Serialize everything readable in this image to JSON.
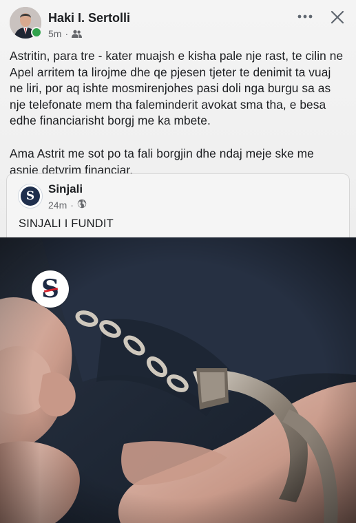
{
  "post": {
    "author": "Haki I. Sertolli",
    "time": "5m",
    "audience_icon": "friends-icon",
    "paragraphs": [
      "Astritin, para tre - kater muajsh e kisha pale nje rast, te cilin ne Apel arritem ta lirojme dhe qe pjesen tjeter te denimit ta vuaj ne liri, por aq ishte mosmirenjohes pasi doli nga burgu sa as nje telefonate mem tha faleminderit avokat sma tha, e besa edhe financiarisht borgj me ka mbete.",
      "Ama Astrit me sot po ta fali borgjin dhe ndaj meje ske me asnje detyrim financiar."
    ]
  },
  "shared": {
    "page_name": "Sinjali",
    "time": "24m",
    "audience_icon": "globe-icon",
    "avatar_letter": "S",
    "text": "SINJALI I FUNDIT"
  },
  "photo": {
    "watermark_letter": "S",
    "subject": "handcuffs"
  },
  "colors": {
    "online": "#31a24c",
    "meta_text": "#65676b",
    "brand_navy": "#1d2a44",
    "brand_red": "#d4202a"
  }
}
